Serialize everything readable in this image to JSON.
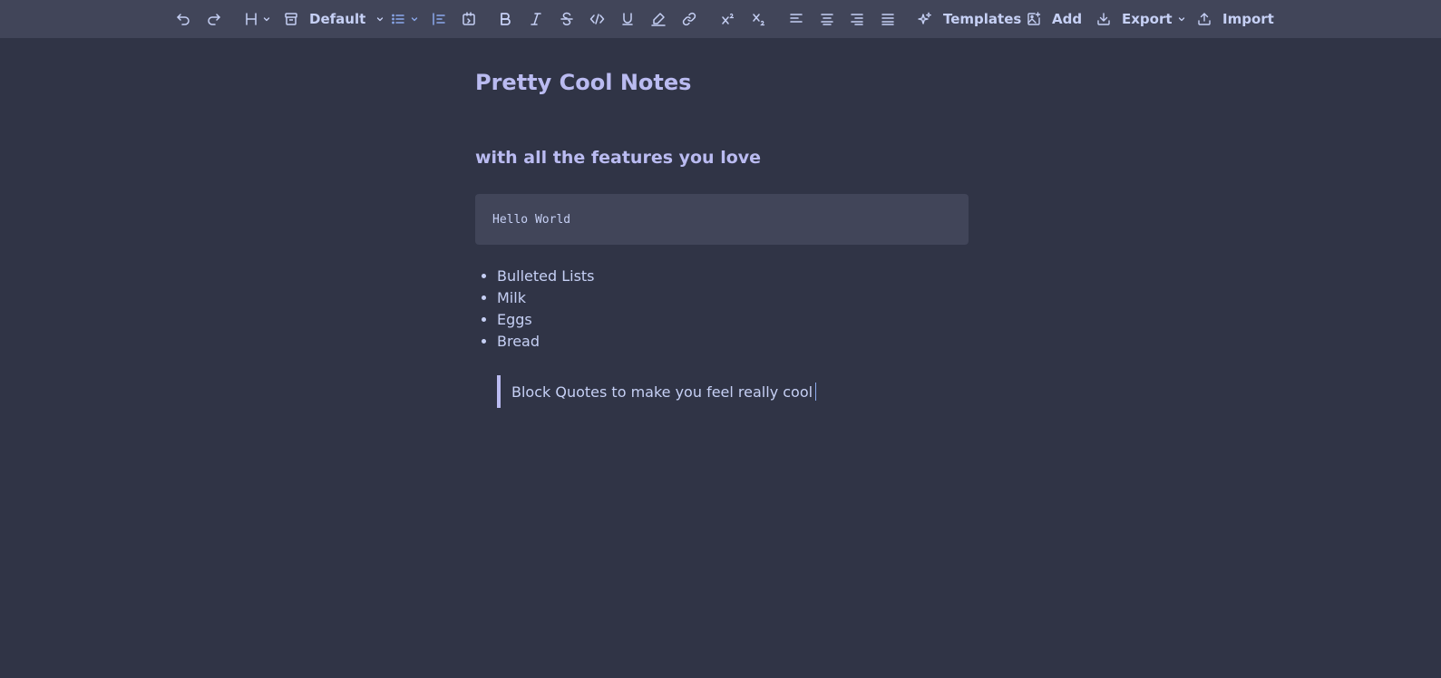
{
  "toolbar": {
    "block_style": "Default",
    "templates_label": "Templates",
    "add_label": "Add",
    "export_label": "Export",
    "import_label": "Import"
  },
  "document": {
    "title": "Pretty Cool Notes",
    "subtitle": "with all the features you love",
    "code": "Hello World",
    "list_items": [
      "Bulleted Lists",
      "Milk",
      "Eggs",
      "Bread"
    ],
    "quote": "Block Quotes to make you feel really cool"
  },
  "colors": {
    "background": "#303446",
    "toolbar": "#414559",
    "text": "#c6d0f5",
    "heading": "#babbf1",
    "accent": "#8caaee"
  }
}
